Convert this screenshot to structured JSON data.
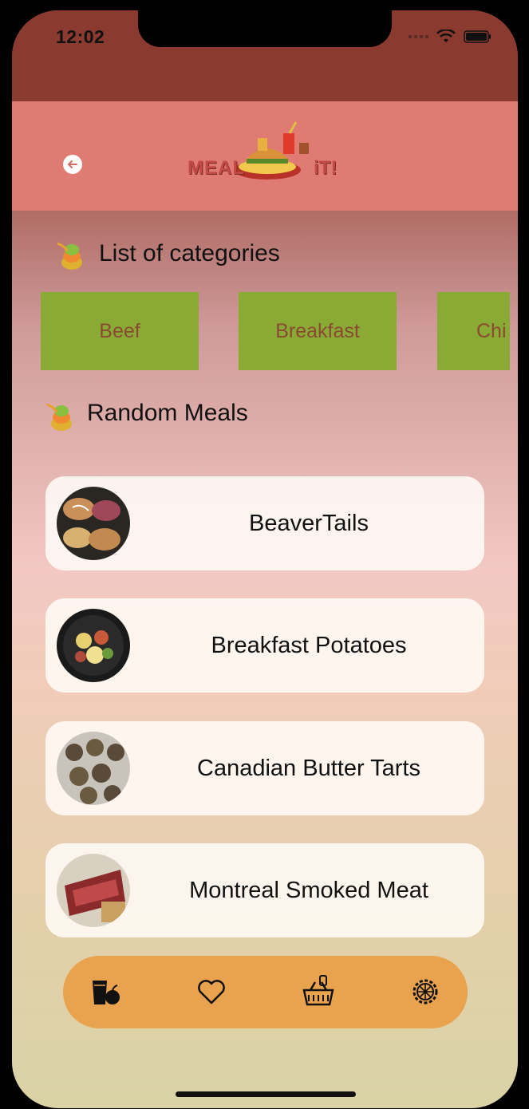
{
  "status": {
    "time": "12:02"
  },
  "header": {
    "logo_left": "MEAL",
    "logo_right": "iT!"
  },
  "categories_section": {
    "title": "List of categories"
  },
  "categories": [
    "Beef",
    "Breakfast",
    "Chi"
  ],
  "random_section": {
    "title": "Random Meals"
  },
  "meals": [
    "BeaverTails",
    "Breakfast Potatoes",
    "Canadian Butter Tarts",
    "Montreal Smoked Meat"
  ],
  "tabbar": {
    "icons": [
      "drinks-icon",
      "heart-icon",
      "basket-icon",
      "settings-icon"
    ]
  },
  "colors": {
    "header": "#e07b74",
    "statusbar": "#8a3a2f",
    "category": "#8aaa36",
    "tabbar": "#e9a24d"
  }
}
